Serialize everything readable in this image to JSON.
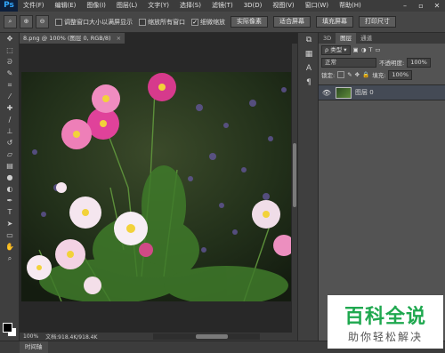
{
  "app": {
    "logo": "Ps"
  },
  "menu": [
    "文件(F)",
    "编辑(E)",
    "图像(I)",
    "图层(L)",
    "文字(Y)",
    "选择(S)",
    "滤镜(T)",
    "3D(D)",
    "视图(V)",
    "窗口(W)",
    "帮助(H)"
  ],
  "options": {
    "check1": "调整窗口大小以满屏显示",
    "check2": "缩放所有窗口",
    "check3": "细微缩放",
    "btn_actual": "实际像素",
    "btn_fit": "适合屏幕",
    "btn_fill": "填充屏幕",
    "btn_print": "打印尺寸"
  },
  "document": {
    "tab_title": "8.png @ 100% (图层 0, RGB/8)",
    "zoom": "100%",
    "doc_info": "文档:918.4K/918.4K"
  },
  "bottom": {
    "label": "时间轴"
  },
  "layers_panel": {
    "tabs": [
      "3D",
      "图层",
      "通道"
    ],
    "filter": "类型",
    "blend_mode": "正常",
    "opacity_label": "不透明度:",
    "opacity": "100%",
    "lock_label": "锁定:",
    "fill_label": "填充:",
    "fill": "100%",
    "layer_name": "图层 0"
  },
  "watermark": {
    "line1": "百科全说",
    "line2": "助你轻松解决"
  }
}
